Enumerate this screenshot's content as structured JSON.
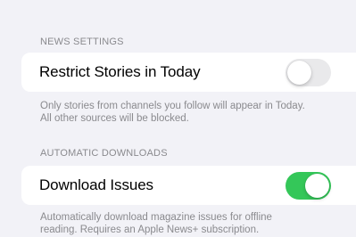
{
  "news_settings": {
    "header": "NEWS SETTINGS",
    "row_label": "Restrict Stories in Today",
    "toggle_on": false,
    "footer_line1": "Only stories from channels you follow will appear in Today.",
    "footer_line2": "All other sources will be blocked."
  },
  "automatic_downloads": {
    "header": "AUTOMATIC DOWNLOADS",
    "row_label": "Download Issues",
    "toggle_on": true,
    "footer_line1": "Automatically download magazine issues for offline",
    "footer_line2": "reading. Requires an Apple News+ subscription."
  },
  "colors": {
    "background": "#f2f2f7",
    "cell": "#ffffff",
    "secondary_text": "#8a8a8e",
    "toggle_on": "#34c759",
    "toggle_off": "#e9e9eb"
  }
}
